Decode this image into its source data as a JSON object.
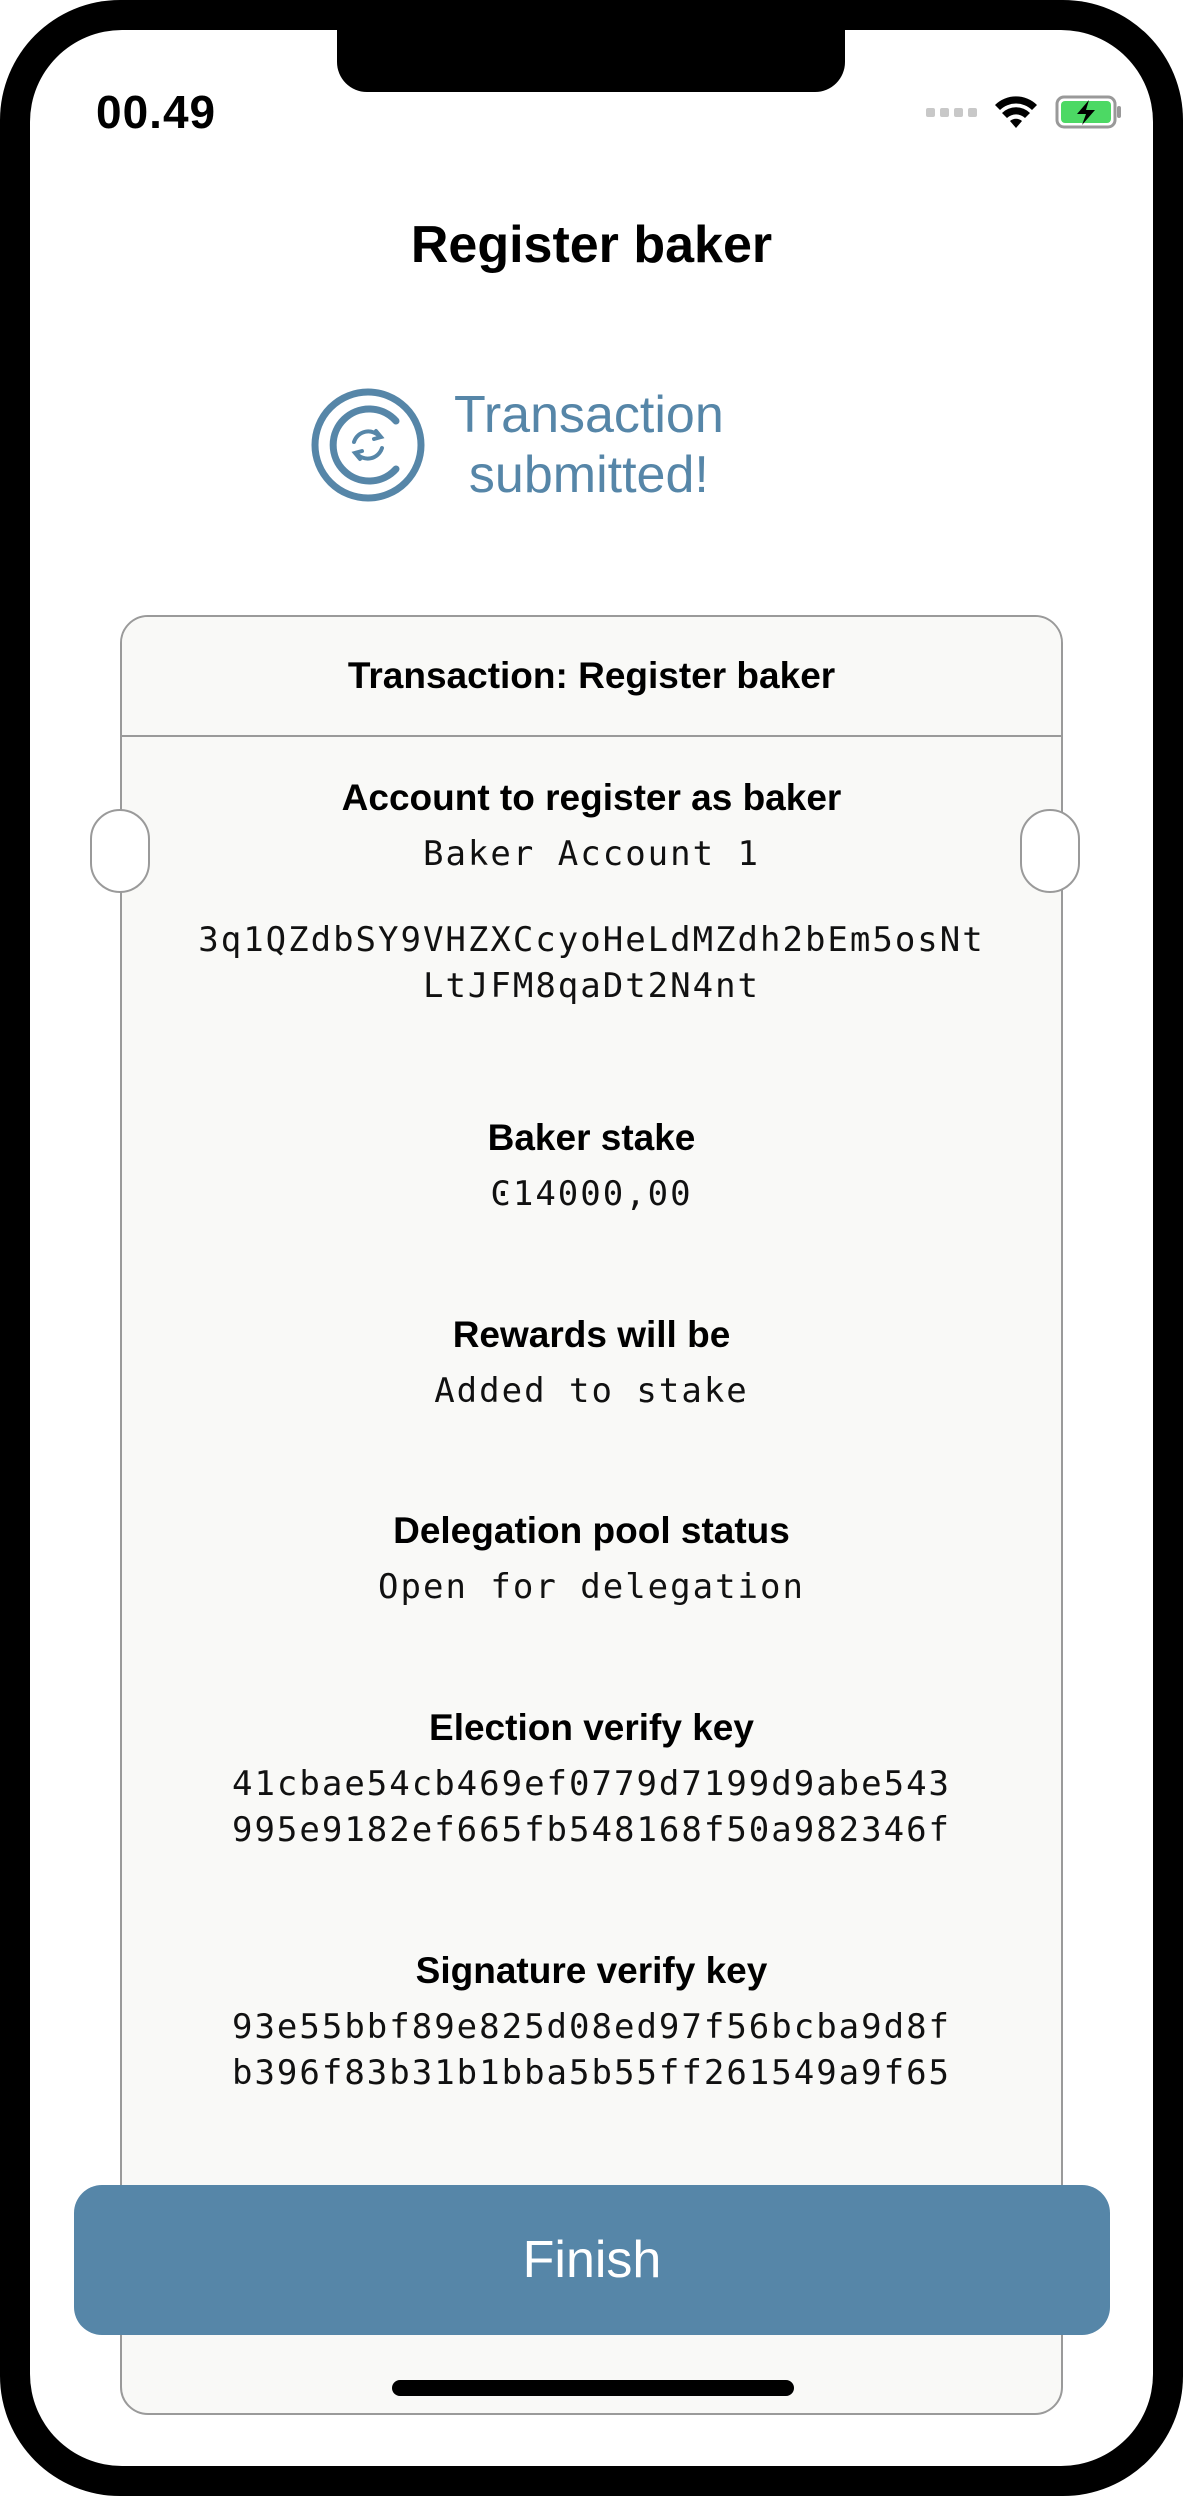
{
  "status_bar": {
    "time": "00.49"
  },
  "header": {
    "title": "Register baker"
  },
  "status": {
    "line1": "Transaction",
    "line2": "submitted!"
  },
  "receipt": {
    "title": "Transaction: Register baker",
    "account": {
      "label": "Account to register as baker",
      "name": "Baker Account 1",
      "address_line1": "3q1QZdbSY9VHZXCcyoHeLdMZdh2bEm5osNt",
      "address_line2": "LtJFM8qaDt2N4nt"
    },
    "stake": {
      "label": "Baker stake",
      "value": "Ͼ14000,00"
    },
    "rewards": {
      "label": "Rewards will be",
      "value": "Added to stake"
    },
    "pool": {
      "label": "Delegation pool status",
      "value": "Open for delegation"
    },
    "election_key": {
      "label": "Election verify key",
      "line1": "41cbae54cb469ef0779d7199d9abe543",
      "line2": "995e9182ef665fb548168f50a982346f"
    },
    "signature_key": {
      "label": "Signature verify key",
      "line1": "93e55bbf89e825d08ed97f56bcba9d8f",
      "line2": "b396f83b31b1bba5b55ff261549a9f65"
    }
  },
  "actions": {
    "finish_label": "Finish"
  },
  "colors": {
    "accent": "#5686a8",
    "battery": "#4cd964"
  },
  "icons": [
    "wifi-icon",
    "battery-charging-icon",
    "concordium-pending-icon"
  ]
}
